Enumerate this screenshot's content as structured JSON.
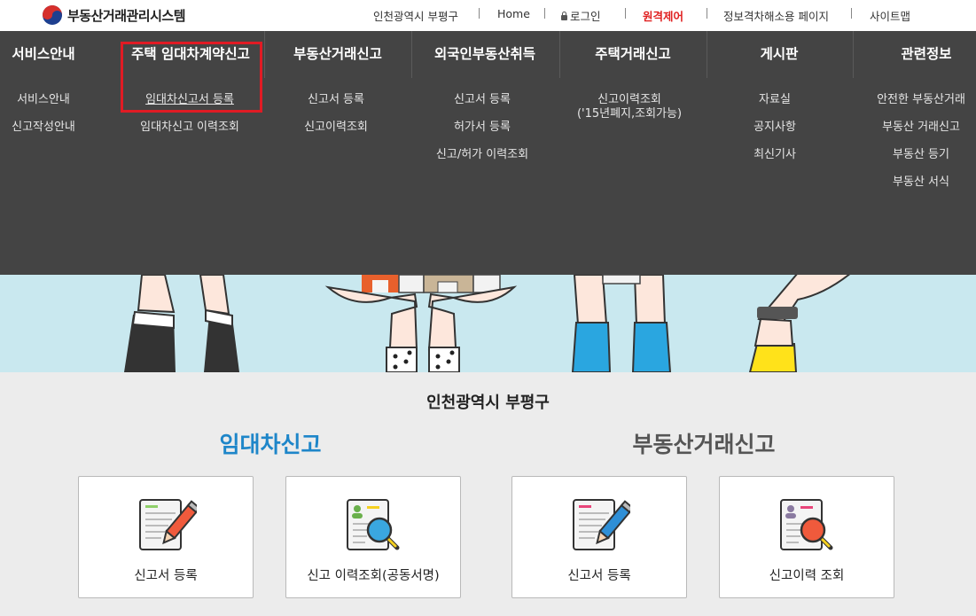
{
  "header": {
    "logo_text": "부동산거래관리시스템",
    "util_links": [
      {
        "label": "인천광역시 부평구"
      },
      {
        "label": "Home"
      },
      {
        "label": "로그인",
        "icon": "lock-icon"
      },
      {
        "label": "원격제어",
        "color": "#e02020"
      },
      {
        "label": "정보격차해소용 페이지"
      },
      {
        "label": "사이트맵"
      }
    ]
  },
  "menu": {
    "columns": [
      {
        "title": "서비스안내",
        "items": [
          "서비스안내",
          "신고작성안내"
        ]
      },
      {
        "title": "주택 임대차계약신고",
        "items": [
          "임대차신고서 등록",
          "임대차신고 이력조회"
        ]
      },
      {
        "title": "부동산거래신고",
        "items": [
          "신고서 등록",
          "신고이력조회"
        ]
      },
      {
        "title": "외국인부동산취득",
        "items": [
          "신고서 등록",
          "허가서 등록",
          "신고/허가 이력조회"
        ]
      },
      {
        "title": "주택거래신고",
        "items": [
          "신고이력조회",
          "('15년폐지,조회가능)"
        ]
      },
      {
        "title": "게시판",
        "items": [
          "자료실",
          "공지사항",
          "최신기사"
        ]
      },
      {
        "title": "관련정보",
        "items": [
          "안전한 부동산거래",
          "부동산 거래신고",
          "부동산 등기",
          "부동산 서식"
        ]
      }
    ],
    "highlight_color": "#e01b24"
  },
  "main": {
    "region": "인천광역시 부평구",
    "sections": [
      {
        "title": "임대차신고",
        "color": "#1e86c9"
      },
      {
        "title": "부동산거래신고",
        "color": "#555555"
      }
    ],
    "cards": [
      {
        "label": "신고서 등록",
        "icon": "document-pencil-icon"
      },
      {
        "label": "신고 이력조회(공동서명)",
        "icon": "document-search-icon"
      },
      {
        "label": "신고서 등록",
        "icon": "document-pencil-icon"
      },
      {
        "label": "신고이력 조회",
        "icon": "document-search-icon"
      }
    ]
  },
  "colors": {
    "menu_bg": "#444444",
    "illustration_bg": "#c9e8ef",
    "content_bg": "#ececec",
    "accent_blue": "#1e86c9"
  }
}
